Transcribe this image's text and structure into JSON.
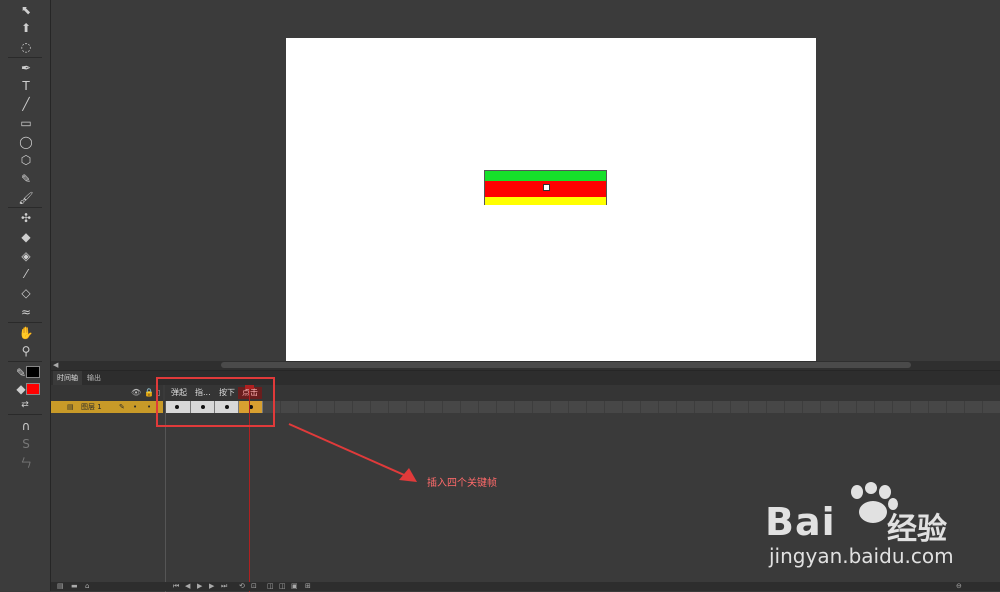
{
  "timeline": {
    "tabs": {
      "timeline": "时间轴",
      "output": "输出"
    },
    "layer": {
      "name": "图层 1"
    },
    "frame_labels": {
      "up": "弹起",
      "over": "指...",
      "down": "按下",
      "hit": "点击"
    }
  },
  "annotation": {
    "text": "插入四个关键帧",
    "color": "#e03a3a"
  },
  "stage": {
    "button_colors": {
      "top": "#16e02a",
      "middle": "#ff0000",
      "bottom": "#ffff00"
    }
  },
  "toolbar": {
    "stroke_color": "#000000",
    "fill_color": "#ff0000",
    "icons": [
      "selection-icon",
      "subselection-icon",
      "lasso-icon",
      "pen-icon",
      "text-icon",
      "line-icon",
      "rectangle-icon",
      "oval-icon",
      "polystar-icon",
      "pencil-icon",
      "brush-icon",
      "bone-icon",
      "paint-bucket-icon",
      "ink-bottle-icon",
      "eyedropper-icon",
      "eraser-icon",
      "width-icon",
      "hand-icon",
      "zoom-icon"
    ]
  },
  "watermark": {
    "brand": "Bai",
    "brand_cn": "经验",
    "url": "jingyan.baidu.com"
  }
}
